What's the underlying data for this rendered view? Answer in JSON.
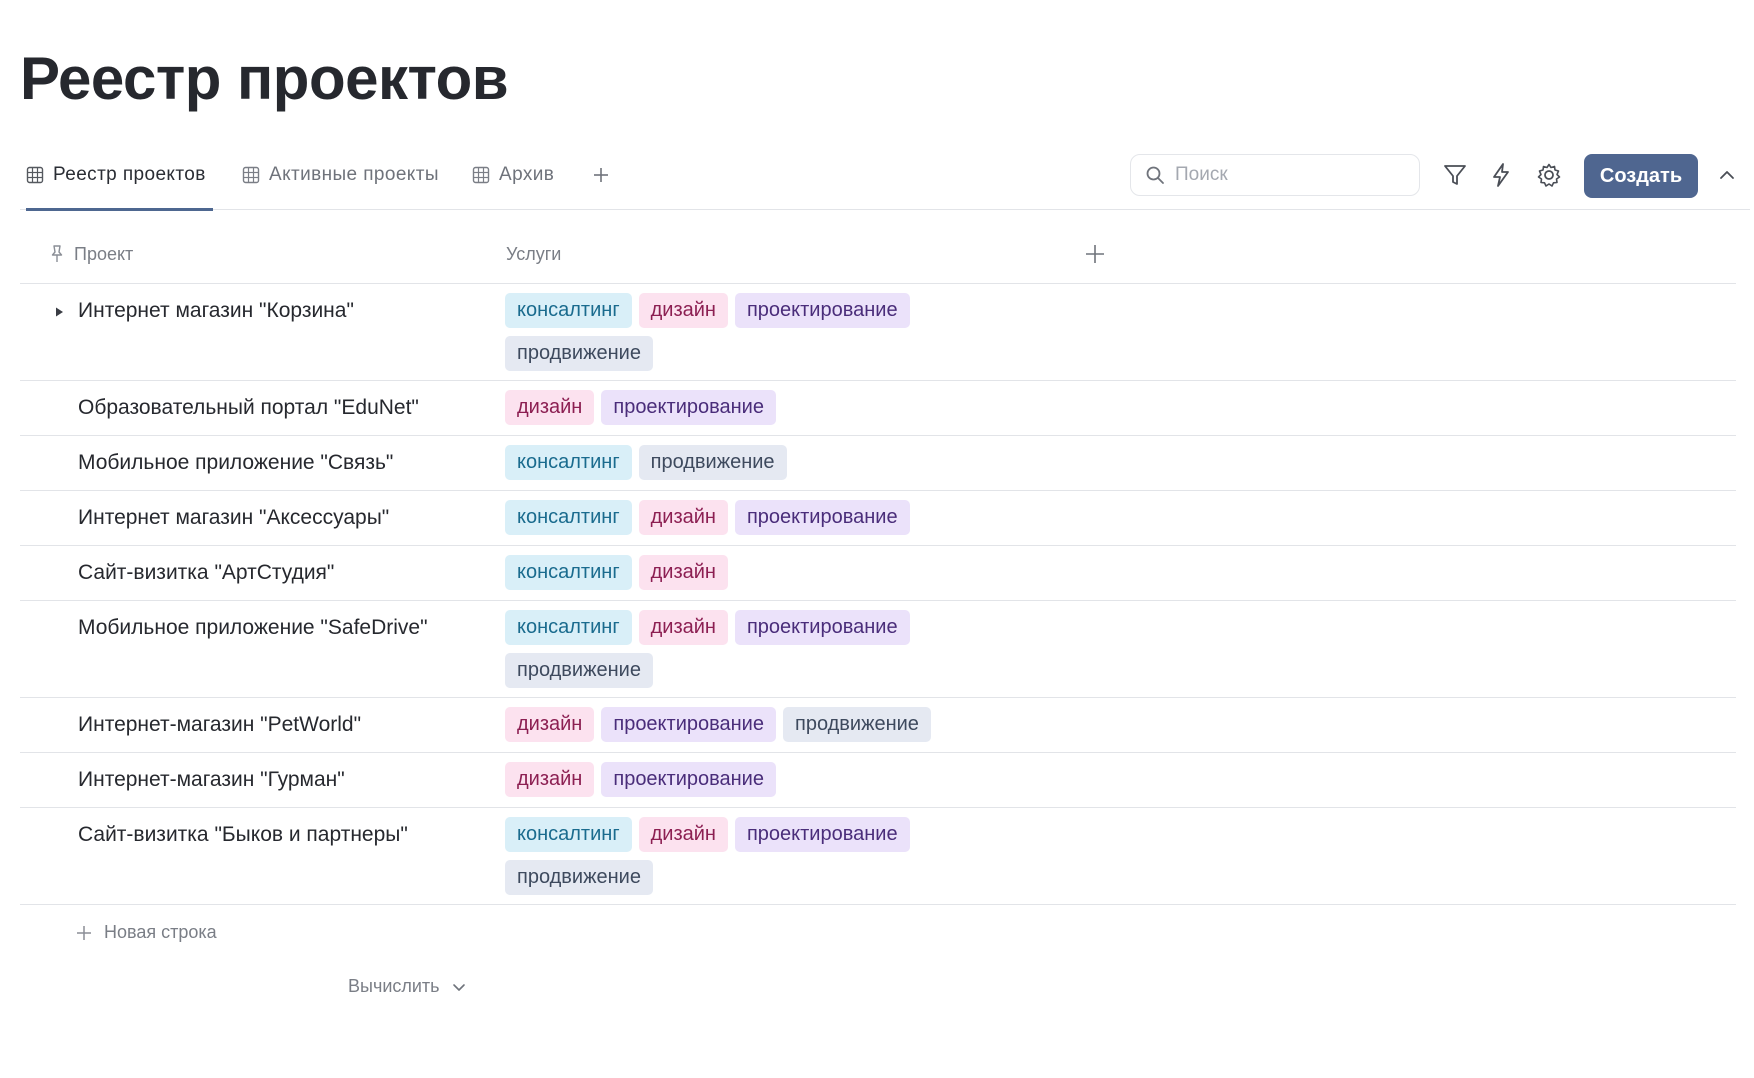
{
  "page": {
    "title": "Реестр проектов"
  },
  "tabs": [
    {
      "label": "Реестр проектов",
      "active": true
    },
    {
      "label": "Активные проекты",
      "active": false
    },
    {
      "label": "Архив",
      "active": false
    }
  ],
  "toolbar": {
    "search_placeholder": "Поиск",
    "create_label": "Создать",
    "accent_color": "#4f6690"
  },
  "table": {
    "columns": {
      "project": "Проект",
      "services": "Услуги"
    },
    "rows": [
      {
        "name": "Интернет магазин \"Корзина\"",
        "tags": [
          {
            "label": "консалтинг",
            "kind": "c"
          },
          {
            "label": "дизайн",
            "kind": "d"
          },
          {
            "label": "проектирование",
            "kind": "p"
          },
          {
            "label": "продвижение",
            "kind": "m"
          }
        ]
      },
      {
        "name": "Образовательный портал \"EduNet\"",
        "tags": [
          {
            "label": "дизайн",
            "kind": "d"
          },
          {
            "label": "проектирование",
            "kind": "p"
          }
        ]
      },
      {
        "name": "Мобильное приложение \"Связь\"",
        "tags": [
          {
            "label": "консалтинг",
            "kind": "c"
          },
          {
            "label": "продвижение",
            "kind": "m"
          }
        ]
      },
      {
        "name": "Интернет магазин \"Аксессуары\"",
        "tags": [
          {
            "label": "консалтинг",
            "kind": "c"
          },
          {
            "label": "дизайн",
            "kind": "d"
          },
          {
            "label": "проектирование",
            "kind": "p"
          }
        ]
      },
      {
        "name": "Сайт-визитка \"АртСтудия\"",
        "tags": [
          {
            "label": "консалтинг",
            "kind": "c"
          },
          {
            "label": "дизайн",
            "kind": "d"
          }
        ]
      },
      {
        "name": "Мобильное приложение \"SafeDrive\"",
        "tags": [
          {
            "label": "консалтинг",
            "kind": "c"
          },
          {
            "label": "дизайн",
            "kind": "d"
          },
          {
            "label": "проектирование",
            "kind": "p"
          },
          {
            "label": "продвижение",
            "kind": "m"
          }
        ]
      },
      {
        "name": "Интернет-магазин \"PetWorld\"",
        "tags": [
          {
            "label": "дизайн",
            "kind": "d"
          },
          {
            "label": "проектирование",
            "kind": "p"
          },
          {
            "label": "продвижение",
            "kind": "m"
          }
        ]
      },
      {
        "name": "Интернет-магазин \"Гурман\"",
        "tags": [
          {
            "label": "дизайн",
            "kind": "d"
          },
          {
            "label": "проектирование",
            "kind": "p"
          }
        ]
      },
      {
        "name": "Сайт-визитка \"Быков и партнеры\"",
        "tags": [
          {
            "label": "консалтинг",
            "kind": "c"
          },
          {
            "label": "дизайн",
            "kind": "d"
          },
          {
            "label": "проектирование",
            "kind": "p"
          },
          {
            "label": "продвижение",
            "kind": "m"
          }
        ]
      }
    ],
    "new_row_label": "Новая строка",
    "calc_label": "Вычислить"
  },
  "icons": {
    "tab": "table-grid-icon",
    "add": "plus-icon",
    "search": "search-icon",
    "filter": "filter-icon",
    "automation": "lightning-icon",
    "settings": "gear-icon",
    "collapse": "chevron-up-icon",
    "pin": "pin-icon",
    "expand": "triangle-right-icon",
    "calc": "chevron-down-icon"
  }
}
